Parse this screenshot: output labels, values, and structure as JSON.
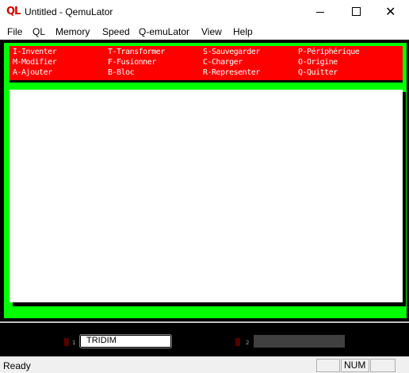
{
  "window": {
    "icon_text": "QL",
    "title": "Untitled - QemuLator"
  },
  "menu": [
    "File",
    "QL",
    "Memory",
    "Speed",
    "Q-emuLator",
    "View",
    "Help"
  ],
  "commands": [
    [
      "I-Inventer",
      "M-Modifier",
      "A-Ajouter"
    ],
    [
      "T-Transformer",
      "F-Fusionner",
      "B-Bloc"
    ],
    [
      "S-Sauvegarder",
      "C-Charger",
      "R-Representer"
    ],
    [
      "P-Périphérique",
      "O-Origine",
      "Q-Quitter"
    ]
  ],
  "drives": {
    "drive1_number": "1",
    "drive1_label": "TRIDIM",
    "drive2_number": "2",
    "drive2_label": ""
  },
  "status": {
    "text": "Ready",
    "num": "NUM"
  },
  "colors": {
    "border": "#00ff00",
    "menu_panel": "#ff0000",
    "text_window": "#ffffff"
  }
}
